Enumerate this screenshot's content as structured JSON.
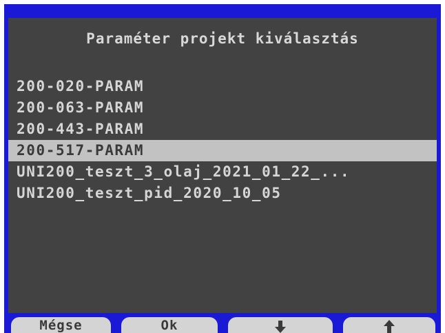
{
  "dialog": {
    "title": "Paraméter projekt kiválasztás"
  },
  "list": {
    "items": [
      {
        "label": "200-020-PARAM",
        "selected": false
      },
      {
        "label": "200-063-PARAM",
        "selected": false
      },
      {
        "label": "200-443-PARAM",
        "selected": false
      },
      {
        "label": "200-517-PARAM",
        "selected": true
      },
      {
        "label": "UNI200_teszt_3_olaj_2021_01_22_...",
        "selected": false
      },
      {
        "label": "UNI200_teszt_pid_2020_10_05",
        "selected": false
      }
    ]
  },
  "buttons": {
    "cancel_label": "Mégse",
    "ok_label": "Ok",
    "down_icon": "arrow-down-icon",
    "up_icon": "arrow-up-icon"
  },
  "colors": {
    "frame": "#1a1ad6",
    "panel": "#424242",
    "text": "#d6d6d6",
    "selection": "#c2c2c2",
    "button": "#d4d4d4"
  }
}
